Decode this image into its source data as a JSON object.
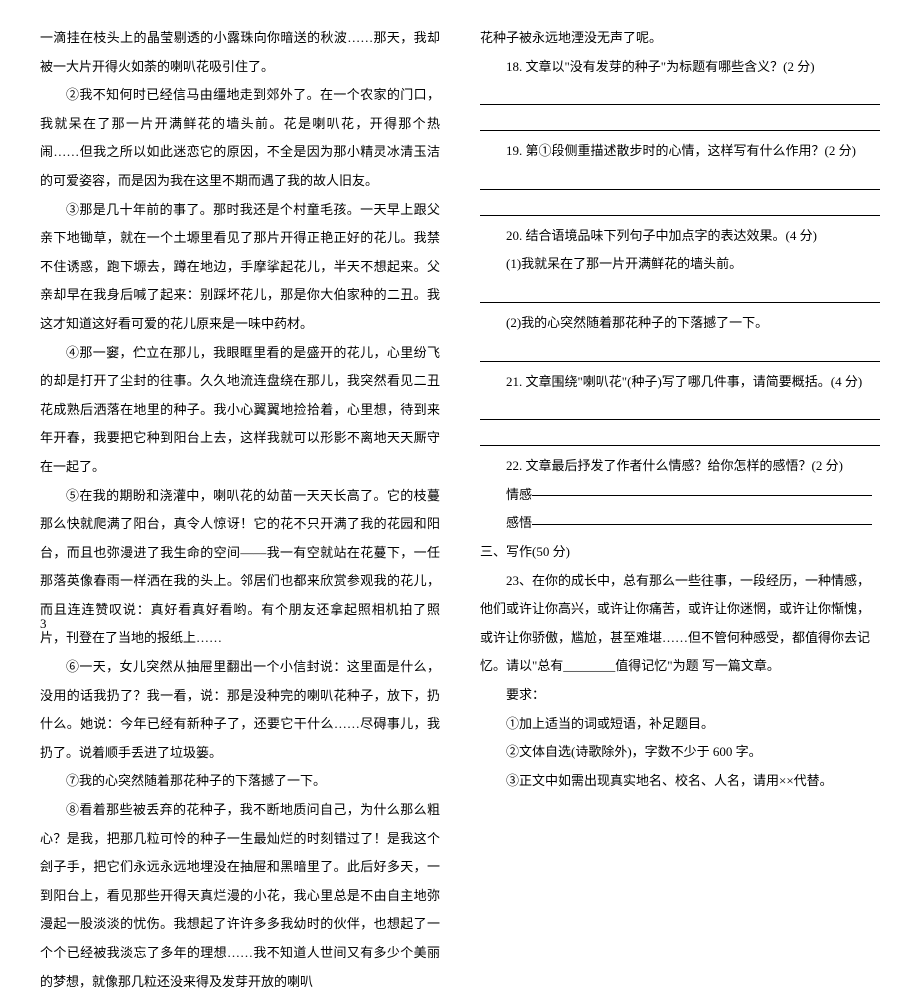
{
  "left": {
    "p1": "一滴挂在枝头上的晶莹剔透的小露珠向你暗送的秋波……那天，我却被一大片开得火如荼的喇叭花吸引住了。",
    "p2": "②我不知何时已经信马由缰地走到郊外了。在一个农家的门口，我就呆在了那一片开满鲜花的墙头前。花是喇叭花，开得那个热闹……但我之所以如此迷恋它的原因，不全是因为那小精灵冰清玉洁的可爱姿容，而是因为我在这里不期而遇了我的故人旧友。",
    "p3": "③那是几十年前的事了。那时我还是个村童毛孩。一天早上跟父亲下地锄草，就在一个土塬里看见了那片开得正艳正好的花儿。我禁不住诱惑，跑下塬去，蹲在地边，手摩挲起花儿，半天不想起来。父亲却早在我身后喊了起来：别踩坏花儿，那是你大伯家种的二丑。我这才知道这好看可爱的花儿原来是一味中药材。",
    "p4": "④那一窭，伫立在那儿，我眼眶里看的是盛开的花儿，心里纷飞的却是打开了尘封的往事。久久地流连盘绕在那儿，我突然看见二丑花成熟后洒落在地里的种子。我小心翼翼地捡拾着，心里想，待到来年开春，我要把它种到阳台上去，这样我就可以形影不离地天天厮守在一起了。",
    "p5": "⑤在我的期盼和浇灌中，喇叭花的幼苗一天天长高了。它的枝蔓那么快就爬满了阳台，真令人惊讶！它的花不只开满了我的花园和阳台，而且也弥漫进了我生命的空间——我一有空就站在花蔓下，一任那落英像春雨一样洒在我的头上。邻居们也都来欣赏参观我的花儿，而且连连赞叹说：真好看真好看哟。有个朋友还拿起照相机拍了照片，刊登在了当地的报纸上……",
    "p6": "⑥一天，女儿突然从抽屉里翻出一个小信封说：这里面是什么，没用的话我扔了？我一看，说：那是没种完的喇叭花种子，放下，扔什么。她说：今年已经有新种子了，还要它干什么……尽碍事儿，我扔了。说着顺手丢进了垃圾篓。",
    "p7": "⑦我的心突然随着那花种子的下落撼了一下。",
    "p8": "⑧看着那些被丢弃的花种子，我不断地质问自己，为什么那么粗心？是我，把那几粒可怜的种子一生最灿烂的时刻错过了！是我这个刽子手，把它们永远永远地埋没在抽屉和黑暗里了。此后好多天，一到阳台上，看见那些开得天真烂漫的小花，我心里总是不由自主地弥漫起一股淡淡的忧伤。我想起了许许多多我幼时的伙伴，也想起了一个个已经被我淡忘了多年的理想……我不知道人世间又有多少个美丽的梦想，就像那几粒还没来得及发芽开放的喇叭"
  },
  "right": {
    "p_cont": "花种子被永远地湮没无声了呢。",
    "q18": "18. 文章以\"没有发芽的种子\"为标题有哪些含义？(2 分)",
    "q19": "19. 第①段侧重描述散步时的心情，这样写有什么作用？(2 分)",
    "q20": "20. 结合语境品味下列句子中加点字的表达效果。(4 分)",
    "q20_1": "(1)我就呆在了那一片开满鲜花的墙头前。",
    "q20_2": "(2)我的心突然随着那花种子的下落撼了一下。",
    "q21": "21. 文章围绕\"喇叭花\"(种子)写了哪几件事，请简要概括。(4 分)",
    "q22": "22. 文章最后抒发了作者什么情感？给你怎样的感悟？(2 分)",
    "q22_a": "情感",
    "q22_b": "感悟",
    "section3": "三、写作(50 分)",
    "q23_a": "23、在你的成长中，总有那么一些往事，一段经历，一种情感，他们或许让你高兴，或许让你痛苦，或许让你迷惘，或许让你惭愧，或许让你骄傲，尴尬，甚至难堪……但不管何种感受，都值得你去记忆。请以\"总有________值得记忆\"为题 写一篇文章。",
    "req_head": "要求：",
    "req1": "①加上适当的词或短语，补足题目。",
    "req2": "②文体自选(诗歌除外)，字数不少于 600 字。",
    "req3": "③正文中如需出现真实地名、校名、人名，请用××代替。"
  },
  "footer": "3"
}
